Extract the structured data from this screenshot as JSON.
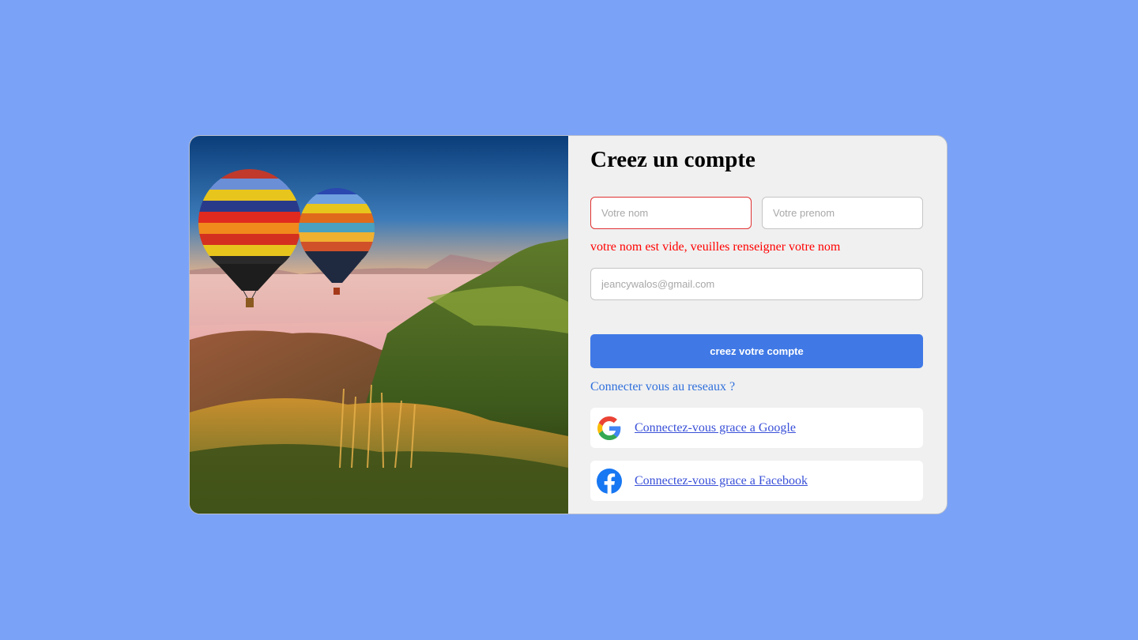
{
  "form": {
    "title": "Creez un compte",
    "nom_placeholder": "Votre nom",
    "prenom_placeholder": "Votre prenom",
    "email_placeholder": "jeancywalos@gmail.com",
    "nom_error": "votre nom est vide, veuilles renseigner votre nom",
    "submit_label": "creez votre compte"
  },
  "social": {
    "question": "Connecter vous au reseaux ?",
    "google_label": "Connectez-vous grace a Google",
    "facebook_label": "Connectez-vous grace a Facebook"
  },
  "colors": {
    "page_background": "#7aa2f7",
    "primary_button": "#4079e6",
    "error": "#ff0000",
    "link": "#3a50d8"
  },
  "icons": {
    "google": "google-icon",
    "facebook": "facebook-icon"
  }
}
